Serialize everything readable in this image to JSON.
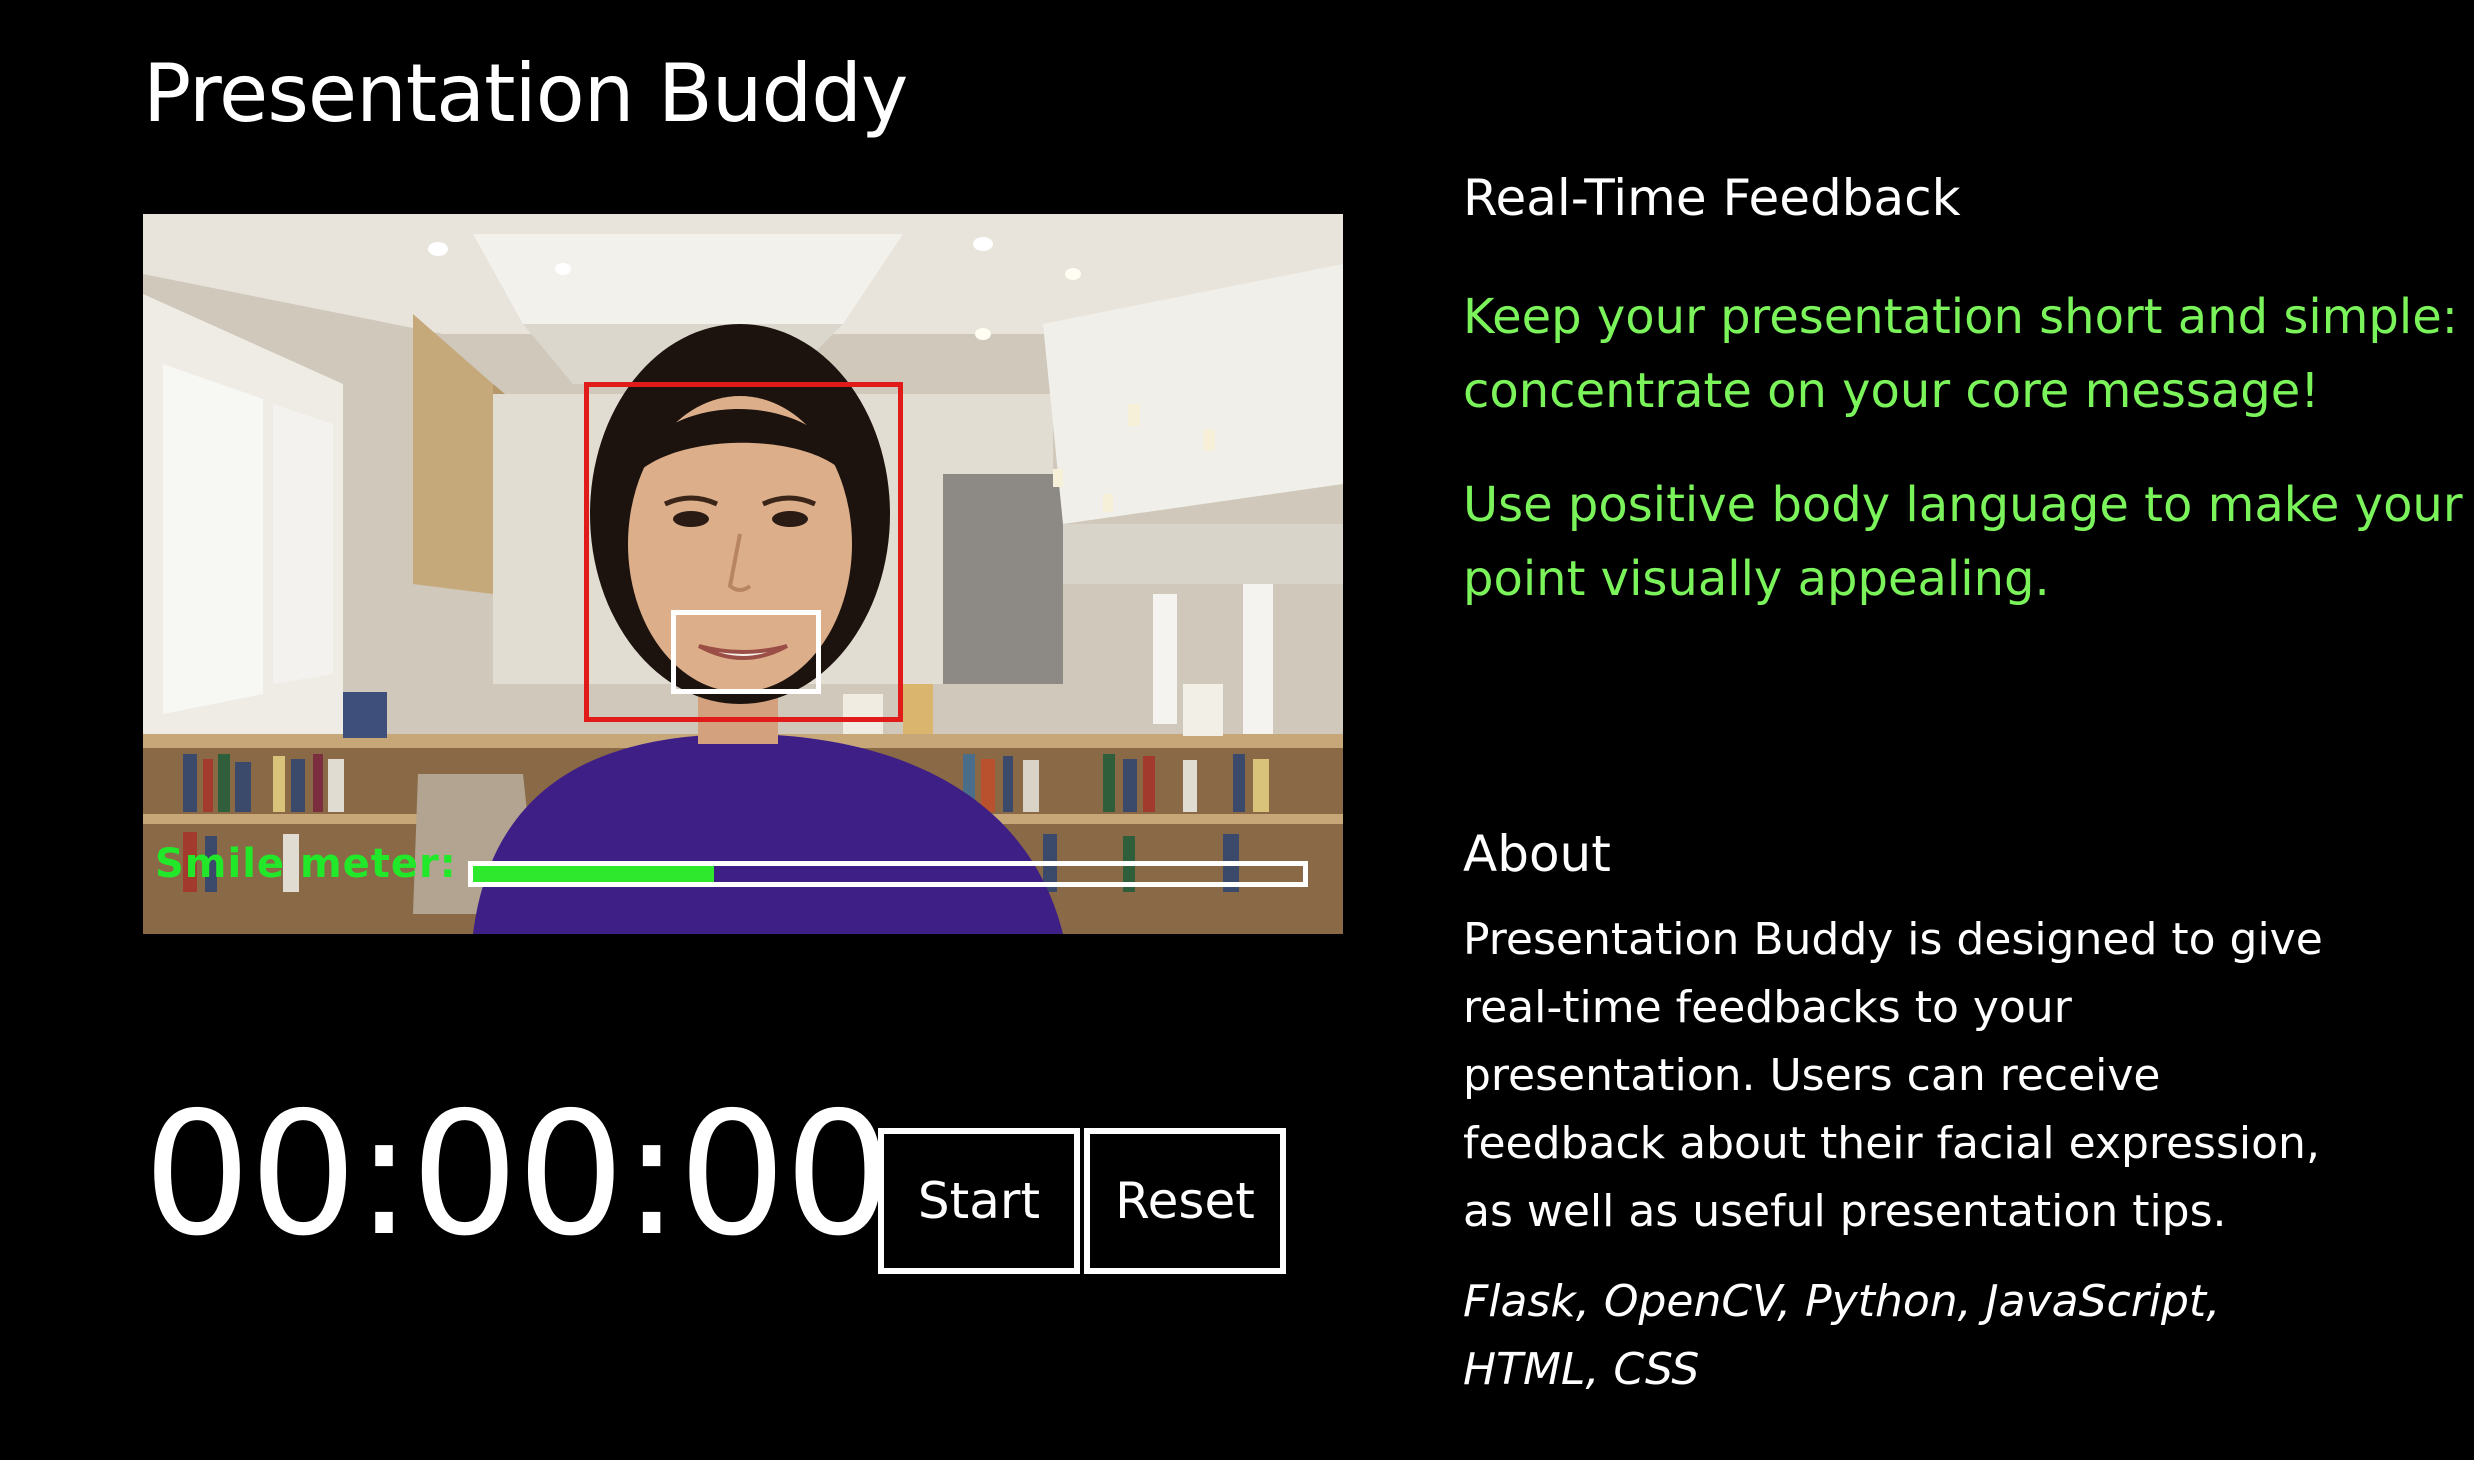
{
  "app": {
    "title": "Presentation Buddy"
  },
  "video": {
    "smile_meter_label": "Smile meter:",
    "smile_level": 0.29,
    "face_box_color": "#e11a1a",
    "mouth_box_color": "#ffffff",
    "meter_fill_color": "#2ee82e"
  },
  "timer": {
    "display": "00:00:00",
    "start_label": "Start",
    "reset_label": "Reset"
  },
  "feedback": {
    "heading": "Real-Time Feedback",
    "tips": [
      "Keep your presentation short and simple: concentrate on your core message!",
      "Use positive body language to make your point visually appealing."
    ],
    "tip_color": "#7bf35a"
  },
  "about": {
    "heading": "About",
    "description": "Presentation Buddy is designed to give real-time feedbacks to your presentation. Users can receive feedback about their facial expression, as well as useful presentation tips.",
    "tech_stack": "Flask, OpenCV, Python, JavaScript, HTML, CSS"
  }
}
